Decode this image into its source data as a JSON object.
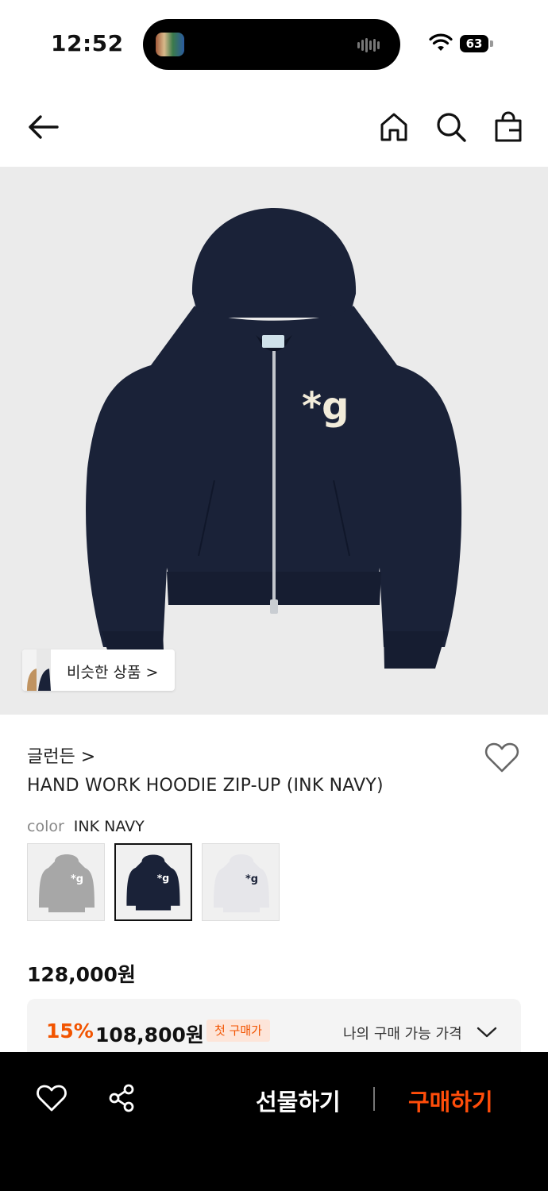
{
  "status_bar": {
    "time": "12:52",
    "battery": "63"
  },
  "nav": {
    "back_icon": "arrow-left-icon",
    "home_icon": "home-icon",
    "search_icon": "search-icon",
    "bag_icon": "shopping-bag-icon"
  },
  "hero": {
    "similar_label": "비슷한 상품 >"
  },
  "product": {
    "brand": "글런든 >",
    "title": "HAND WORK HOODIE ZIP-UP (INK NAVY)",
    "color_label": "color",
    "color_value": "INK NAVY",
    "colors": [
      {
        "hex": "#a7a7a7",
        "selected": false
      },
      {
        "hex": "#1a2238",
        "selected": true
      },
      {
        "hex": "#e6e6ea",
        "selected": false
      }
    ],
    "price": "128,000원",
    "discount": {
      "percent": "15%",
      "sale_price": "108,800원",
      "badge": "첫 구매가",
      "my_price_label": "나의 구매 가능 가격"
    }
  },
  "bottom_bar": {
    "gift_label": "선물하기",
    "buy_label": "구매하기"
  },
  "colors": {
    "accent": "#f25400",
    "buy": "#ff4d0a",
    "hoodie": "#1a2238"
  }
}
